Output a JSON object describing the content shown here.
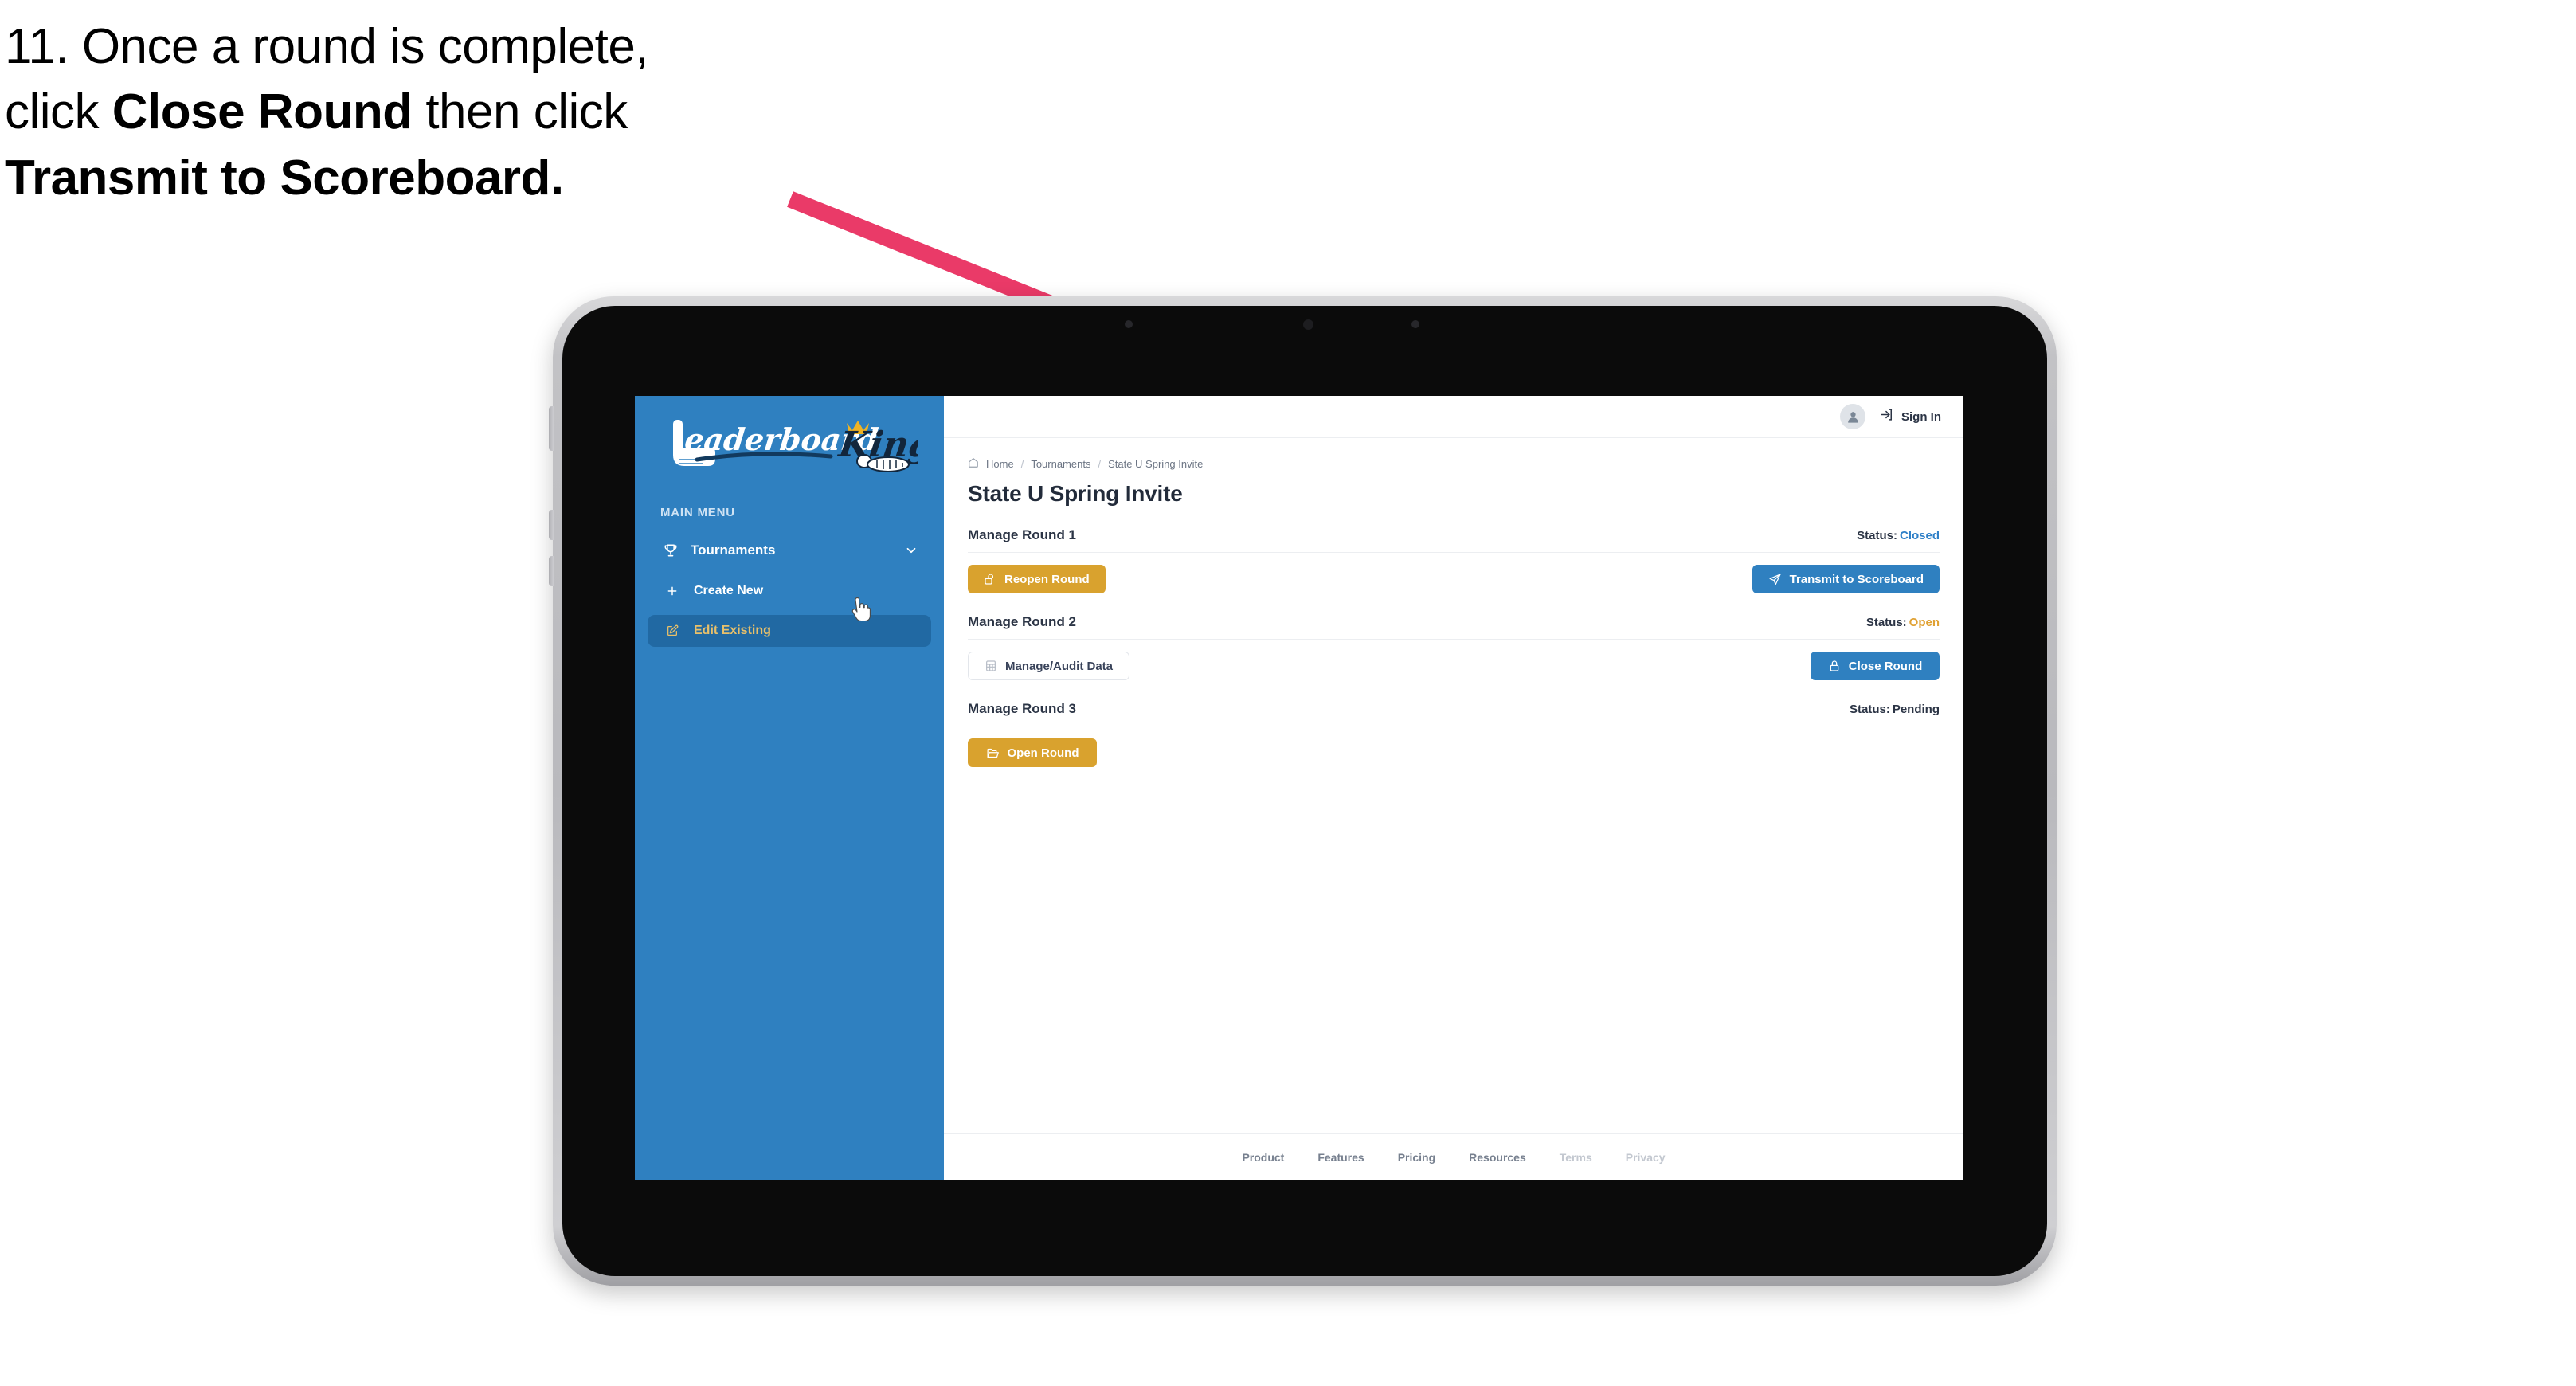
{
  "caption": {
    "line1_prefix": "11. Once a round is complete,",
    "line2_prefix": "click ",
    "line2_bold": "Close Round",
    "line2_suffix": " then click",
    "line3_bold": "Transmit to Scoreboard."
  },
  "sidebar": {
    "logo_text": "LeaderboardKing",
    "section_label": "MAIN MENU",
    "nav": {
      "label": "Tournaments",
      "icon": "trophy-icon",
      "chevron": "chevron-down-icon"
    },
    "sub_items": [
      {
        "label": "Create New",
        "icon": "plus-icon",
        "selected": false
      },
      {
        "label": "Edit Existing",
        "icon": "edit-pencil-icon",
        "selected": true
      }
    ]
  },
  "topbar": {
    "avatar_icon": "user-avatar-icon",
    "signin_icon": "login-arrow-icon",
    "signin_label": "Sign In"
  },
  "breadcrumb": {
    "home_icon": "home-icon",
    "items": [
      "Home",
      "Tournaments",
      "State U Spring Invite"
    ],
    "separator": "/"
  },
  "page": {
    "title": "State U Spring Invite"
  },
  "rounds": [
    {
      "title": "Manage Round 1",
      "status_label": "Status:",
      "status_value": "Closed",
      "status_color": "#2f80c8",
      "left_button": {
        "label": "Reopen Round",
        "style": "gold",
        "icon": "unlock-icon"
      },
      "right_button": {
        "label": "Transmit to Scoreboard",
        "style": "blue",
        "icon": "paper-plane-icon"
      }
    },
    {
      "title": "Manage Round 2",
      "status_label": "Status:",
      "status_value": "Open",
      "status_color": "#e0a133",
      "left_button": {
        "label": "Manage/Audit Data",
        "style": "outline",
        "icon": "table-grid-icon"
      },
      "right_button": {
        "label": "Close Round",
        "style": "blue",
        "icon": "lock-icon"
      }
    },
    {
      "title": "Manage Round 3",
      "status_label": "Status:",
      "status_value": "Pending",
      "status_color": "#2b3445",
      "left_button": {
        "label": "Open Round",
        "style": "gold",
        "icon": "open-folder-icon"
      },
      "right_button": null
    }
  ],
  "footer": {
    "links": [
      {
        "label": "Product",
        "muted": false
      },
      {
        "label": "Features",
        "muted": false
      },
      {
        "label": "Pricing",
        "muted": false
      },
      {
        "label": "Resources",
        "muted": false
      },
      {
        "label": "Terms",
        "muted": true
      },
      {
        "label": "Privacy",
        "muted": true
      }
    ]
  },
  "colors": {
    "brand_blue": "#2f80c0",
    "gold": "#d9a22e",
    "annotation_pink": "#ea3a68",
    "sidebar_selected": "#2169a3",
    "gold_text": "#e8c06a"
  }
}
